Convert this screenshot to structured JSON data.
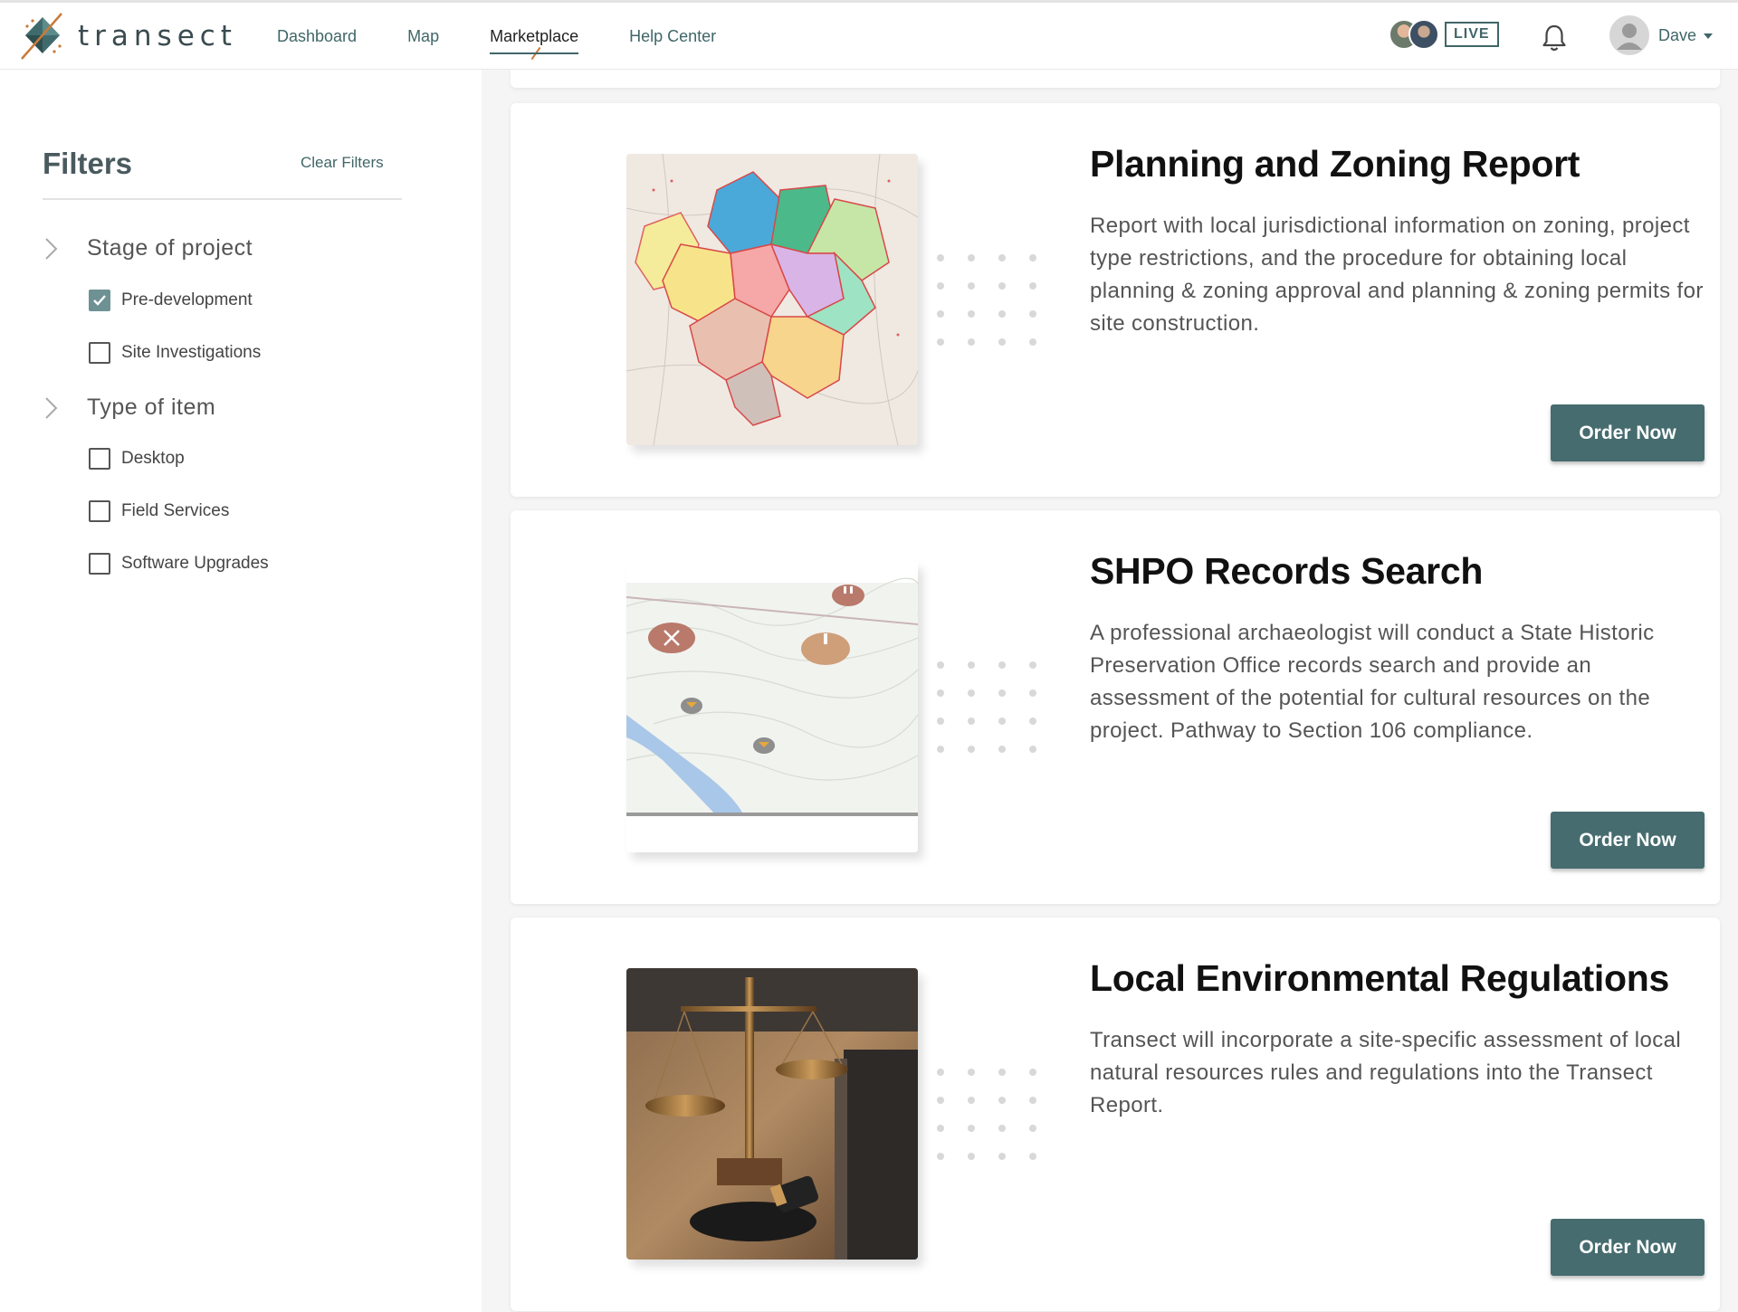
{
  "header": {
    "logo_text": "transect",
    "nav": [
      {
        "label": "Dashboard",
        "active": false
      },
      {
        "label": "Map",
        "active": false
      },
      {
        "label": "Marketplace",
        "active": true
      },
      {
        "label": "Help Center",
        "active": false
      }
    ],
    "live_label": "LIVE",
    "user_name": "Dave",
    "icons": [
      "logo-icon",
      "bell-icon",
      "user-avatar",
      "chevron-down-icon"
    ]
  },
  "sidebar": {
    "title": "Filters",
    "clear_label": "Clear Filters",
    "groups": [
      {
        "label": "Stage of project",
        "options": [
          {
            "label": "Pre-development",
            "checked": true
          },
          {
            "label": "Site Investigations",
            "checked": false
          }
        ]
      },
      {
        "label": "Type of item",
        "options": [
          {
            "label": "Desktop",
            "checked": false
          },
          {
            "label": "Field Services",
            "checked": false
          },
          {
            "label": "Software Upgrades",
            "checked": false
          }
        ]
      }
    ]
  },
  "products": [
    {
      "title": "Planning and Zoning Report",
      "description": "Report with local jurisdictional information on zoning, project type restrictions, and the procedure for obtaining local planning & zoning approval and planning & zoning permits for site construction.",
      "button": "Order Now",
      "image": "zoning-map"
    },
    {
      "title": "SHPO Records Search",
      "description": "A professional archaeologist will conduct a State Historic Preservation Office records search and provide an assessment of the potential for cultural resources on the project. Pathway to Section 106 compliance.",
      "button": "Order Now",
      "image": "topographic-map"
    },
    {
      "title": "Local Environmental Regulations",
      "description": "Transect will incorporate a site-specific assessment of local natural resources rules and regulations into the Transect Report.",
      "button": "Order Now",
      "image": "scales-of-justice-photo"
    }
  ],
  "colors": {
    "brand": "#406668",
    "button": "#466c6f",
    "accent": "#c97a3a",
    "checkbox_checked": "#6e9294"
  }
}
